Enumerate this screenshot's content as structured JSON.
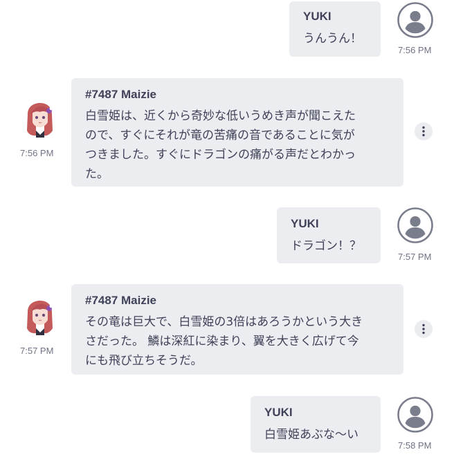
{
  "messages": [
    {
      "type": "user",
      "sender": "YUKI",
      "lines": [
        "うんうん！"
      ],
      "time": "7:56 PM"
    },
    {
      "type": "bot",
      "sender": "#7487 Maizie",
      "lines": [
        "白雪姫は、近くから奇妙な低いうめき声が聞こえた",
        "ので、すぐにそれが竜の苦痛の音であることに気が",
        "つきました。すぐにドラゴンの痛がる声だとわかっ",
        "た。"
      ],
      "time": "7:56 PM"
    },
    {
      "type": "user",
      "sender": "YUKI",
      "lines": [
        "ドラゴン！？"
      ],
      "time": "7:57 PM"
    },
    {
      "type": "bot",
      "sender": "#7487 Maizie",
      "lines": [
        "その竜は巨大で、白雪姫の3倍はあろうかという大き",
        "さだった。 鱗は深紅に染まり、翼を大きく広げて今",
        "にも飛び立ちそうだ。"
      ],
      "time": "7:57 PM"
    },
    {
      "type": "user",
      "sender": "YUKI",
      "lines": [
        "白雪姫あぶな〜い"
      ],
      "time": "7:58 PM"
    }
  ],
  "icons": {
    "user_avatar": "user-avatar-icon",
    "bot_avatar": "anime-girl-avatar",
    "more": "more-vertical-icon"
  },
  "colors": {
    "bubble": "#ecedf1",
    "text": "#3f4258",
    "timestamp": "#6f7284",
    "avatar_gray": "#7a7d8c"
  }
}
